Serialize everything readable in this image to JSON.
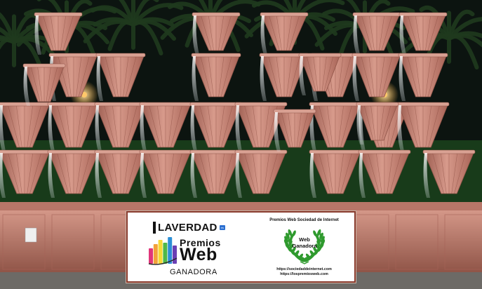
{
  "scene": {
    "colors": {
      "sky": "#0c1410",
      "terracotta": "#c98b7c",
      "terracotta_dark": "#8f5448",
      "palm": "#1f3a1e",
      "light": "#ffc86a",
      "water": "#e8ecef"
    }
  },
  "badge": {
    "left": {
      "brand": "LAVERDAD",
      "brand_tag": "es",
      "line1": "Premios",
      "line2": "Web",
      "status": "GANADORA",
      "bar_colors": [
        "#e0367a",
        "#f2a23a",
        "#f6d935",
        "#4fb848",
        "#2c8fd6",
        "#6a3fb4"
      ]
    },
    "right": {
      "organizer": "Premios Web Sociedad de Internet",
      "wreath_line1": "Web",
      "wreath_line2": "Ganadora",
      "url1": "https://sociedaddeinternet.com",
      "url2": "https://lospremiosweb.com",
      "wreath_color": "#2f9a2e"
    }
  }
}
